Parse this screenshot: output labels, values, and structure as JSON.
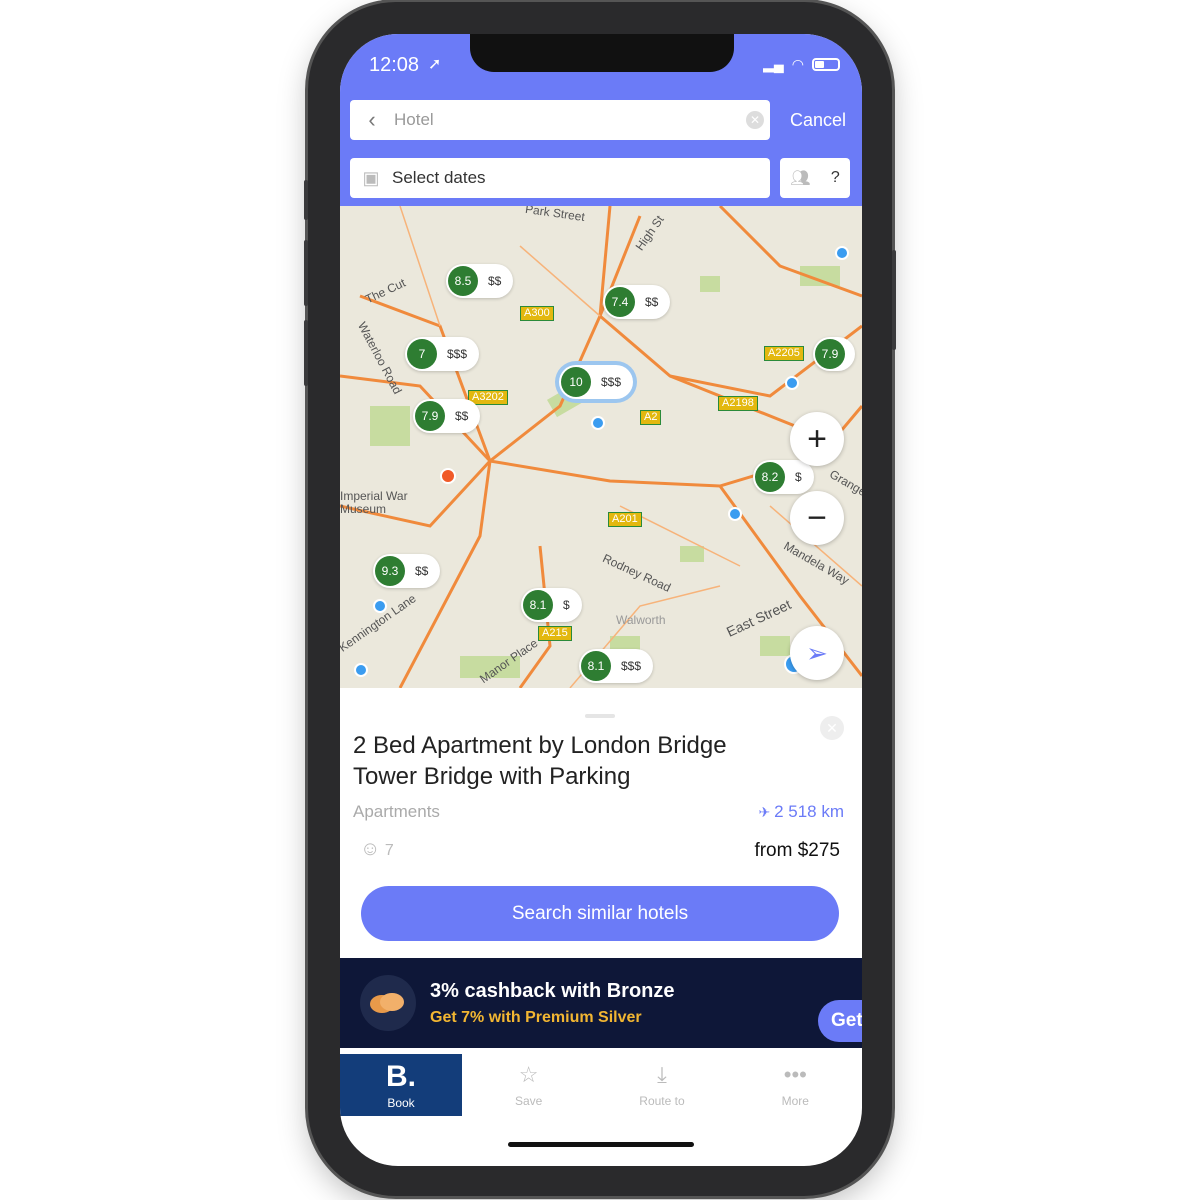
{
  "status": {
    "time": "12:08"
  },
  "search": {
    "placeholder": "Hotel",
    "cancel": "Cancel",
    "dates": "Select dates",
    "guests": "?"
  },
  "map": {
    "markers": [
      {
        "rating": "8.5",
        "price": "$$"
      },
      {
        "rating": "7.4",
        "price": "$$"
      },
      {
        "rating": "7",
        "price": "$$$"
      },
      {
        "rating": "10",
        "price": "$$$",
        "selected": true
      },
      {
        "rating": "7.9",
        "price": "$$"
      },
      {
        "rating": "7.9",
        "price": ""
      },
      {
        "rating": "8.2",
        "price": "$"
      },
      {
        "rating": "9.3",
        "price": "$$"
      },
      {
        "rating": "8.1",
        "price": "$"
      },
      {
        "rating": "8.1",
        "price": "$$$"
      }
    ],
    "road_labels": [
      "A300",
      "A3202",
      "A2",
      "A2198",
      "A2205",
      "A201",
      "A215"
    ],
    "street_labels": [
      "Park Street",
      "High St",
      "The Cut",
      "Waterloo Road",
      "Imperial War Museum",
      "Rodney Road",
      "Walworth",
      "Mandela Way",
      "East Street",
      "Kennington Lane",
      "Manor Place",
      "Grange"
    ],
    "zoom_in": "+",
    "zoom_out": "−"
  },
  "listing": {
    "title": "2 Bed Apartment by London Bridge Tower Bridge with Parking",
    "category": "Apartments",
    "distance": "2 518 km",
    "score": "7",
    "price": "from $275",
    "cta": "Search similar hotels"
  },
  "promo": {
    "title": "3% cashback with Bronze",
    "subtitle": "Get 7% with Premium Silver",
    "button": "Get"
  },
  "tabs": [
    {
      "label": "Book",
      "icon": "B."
    },
    {
      "label": "Save",
      "icon": "star-icon"
    },
    {
      "label": "Route to",
      "icon": "route-icon"
    },
    {
      "label": "More",
      "icon": "more-icon"
    }
  ],
  "colors": {
    "accent": "#6b7bf7",
    "rating": "#2e7d32",
    "promo_bg": "#0e1738",
    "promo_highlight": "#f2b632",
    "book_tab": "#133d7a"
  }
}
